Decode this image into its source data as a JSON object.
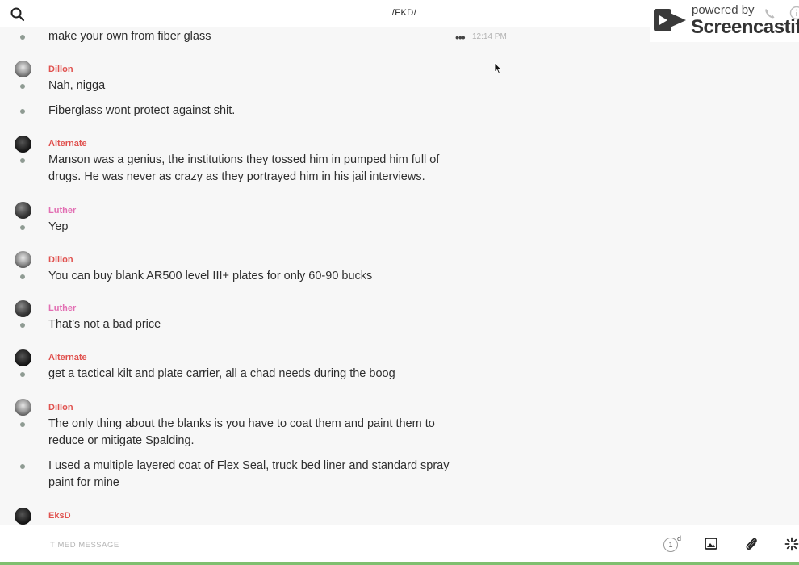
{
  "header": {
    "channel_title": "/FKD/"
  },
  "watermark": {
    "powered_by": "powered by",
    "brand": "Screencastify"
  },
  "first_message": {
    "text": "make your own from fiber glass",
    "timestamp": "12:14 PM",
    "more_label": "•••"
  },
  "messages": [
    {
      "author": "Dillon",
      "author_color": "#e0524f",
      "avatar": "light",
      "lines": [
        "Nah, nigga",
        "Fiberglass wont protect against shit."
      ]
    },
    {
      "author": "Alternate",
      "author_color": "#e0524f",
      "avatar": "dark",
      "lines": [
        "Manson was a genius, the institutions they tossed him in pumped him full of drugs. He was never as crazy as they portrayed him in his jail interviews."
      ]
    },
    {
      "author": "Luther",
      "author_color": "#e26fb3",
      "avatar": "medium",
      "lines": [
        "Yep"
      ]
    },
    {
      "author": "Dillon",
      "author_color": "#e0524f",
      "avatar": "light",
      "lines": [
        "You can buy blank AR500 level III+ plates for only 60-90 bucks"
      ]
    },
    {
      "author": "Luther",
      "author_color": "#e26fb3",
      "avatar": "medium",
      "lines": [
        "That’s not a bad price"
      ]
    },
    {
      "author": "Alternate",
      "author_color": "#e0524f",
      "avatar": "dark",
      "lines": [
        "get a tactical kilt and plate carrier, all a chad needs during the boog"
      ]
    },
    {
      "author": "Dillon",
      "author_color": "#e0524f",
      "avatar": "light",
      "lines": [
        "The only thing about the blanks is you have to coat them and paint them to reduce or mitigate Spalding.",
        "I used a multiple layered coat of Flex Seal, truck bed liner and standard spray paint for mine"
      ]
    },
    {
      "author": "EksD",
      "author_color": "#e0524f",
      "avatar": "dark",
      "lines": []
    }
  ],
  "composer": {
    "placeholder": "TIMED MESSAGE",
    "timer_value": "1",
    "timer_unit": "d"
  },
  "icons": {
    "search": "search-icon",
    "phone": "phone-icon",
    "info": "info-icon",
    "image": "image-icon",
    "attach": "paperclip-icon",
    "effects": "sparkle-icon",
    "more": "more-dots-icon",
    "cursor": "mouse-cursor-icon"
  },
  "colors": {
    "accent_red": "#e0524f",
    "accent_pink": "#e26fb3",
    "bullet": "#8f9b93",
    "status_green": "#7fbf6f"
  }
}
